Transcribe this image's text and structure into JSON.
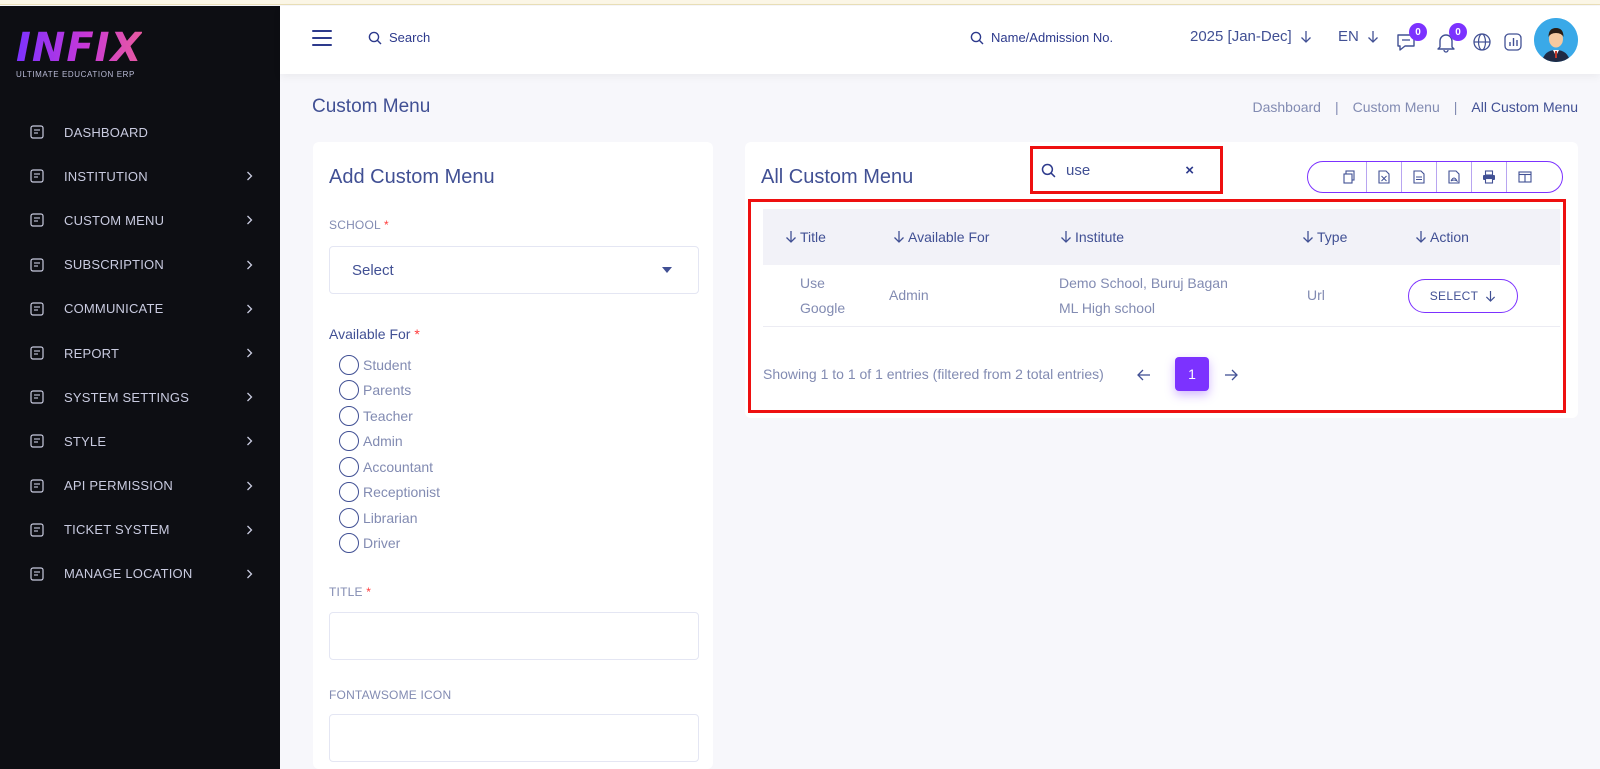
{
  "brand": {
    "logo_text": "INFIX",
    "tagline": "ULTIMATE EDUCATION ERP"
  },
  "sidebar": {
    "items": [
      {
        "label": "DASHBOARD",
        "icon": "dashboard-icon",
        "has_children": false
      },
      {
        "label": "INSTITUTION",
        "icon": "institution-icon",
        "has_children": true
      },
      {
        "label": "CUSTOM MENU",
        "icon": "custom-menu-icon",
        "has_children": true
      },
      {
        "label": "SUBSCRIPTION",
        "icon": "subscription-icon",
        "has_children": true
      },
      {
        "label": "COMMUNICATE",
        "icon": "communicate-icon",
        "has_children": true
      },
      {
        "label": "REPORT",
        "icon": "report-icon",
        "has_children": true
      },
      {
        "label": "SYSTEM SETTINGS",
        "icon": "settings-icon",
        "has_children": true
      },
      {
        "label": "STYLE",
        "icon": "style-icon",
        "has_children": true
      },
      {
        "label": "API PERMISSION",
        "icon": "api-icon",
        "has_children": true
      },
      {
        "label": "TICKET SYSTEM",
        "icon": "ticket-icon",
        "has_children": true
      },
      {
        "label": "MANAGE LOCATION",
        "icon": "location-icon",
        "has_children": true
      }
    ]
  },
  "header": {
    "search_label": "Search",
    "name_search_label": "Name/Admission No.",
    "academic_year": "2025 [Jan-Dec]",
    "language": "EN",
    "message_count": "0",
    "notification_count": "0"
  },
  "page": {
    "title": "Custom Menu",
    "breadcrumb": [
      "Dashboard",
      "|",
      "Custom Menu",
      "|",
      "All Custom Menu"
    ]
  },
  "form": {
    "title": "Add Custom Menu",
    "school_label": "SCHOOL",
    "school_value": "Select",
    "available_for_label": "Available For",
    "roles": [
      "Student",
      "Parents",
      "Teacher",
      "Admin",
      "Accountant",
      "Receptionist",
      "Librarian",
      "Driver"
    ],
    "title_label": "TITLE",
    "icon_label": "FONTAWSOME ICON",
    "required_mark": "*"
  },
  "list": {
    "title": "All Custom Menu",
    "search_value": "use",
    "clear_symbol": "×",
    "export_buttons": [
      "copy-icon",
      "excel-icon",
      "csv-icon",
      "pdf-icon",
      "print-icon",
      "columns-icon"
    ],
    "columns": [
      "Title",
      "Available For",
      "Institute",
      "Type",
      "Action"
    ],
    "rows": [
      {
        "title_line1": "Use",
        "title_line2": "Google",
        "available_for": "Admin",
        "institute_line1": "Demo School, Buruj Bagan",
        "institute_line2": "ML High school",
        "type": "Url",
        "action_label": "SELECT"
      }
    ],
    "pagination_info": "Showing 1 to 1 of 1 entries (filtered from 2 total entries)",
    "current_page": "1"
  },
  "colors": {
    "accent": "#7c32ff",
    "text": "#415094",
    "muted": "#828bb2",
    "sidebar_bg": "#0d0e13",
    "highlight": "#ee1010"
  }
}
